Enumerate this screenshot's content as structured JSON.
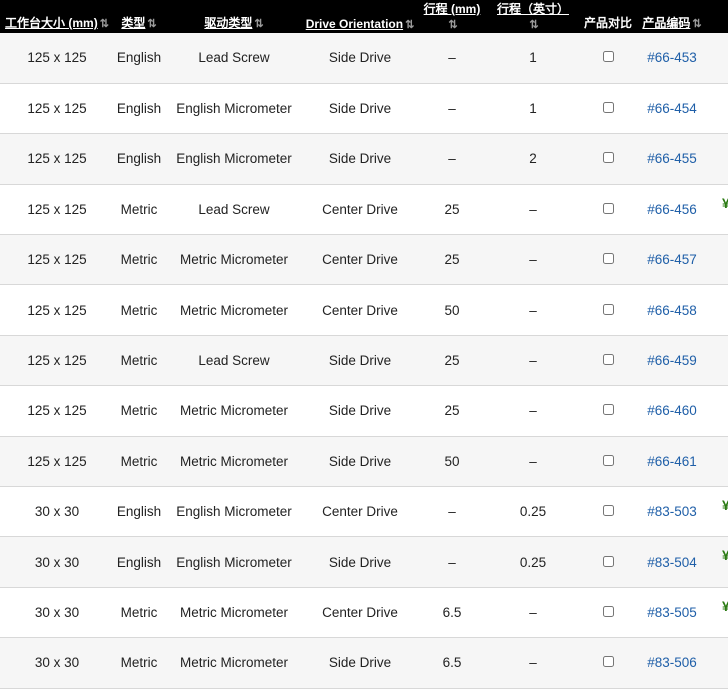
{
  "headers": {
    "stage_size": "工作台大小 (mm)",
    "type": "类型",
    "drive_type": "驱动类型",
    "drive_orientation": "Drive Orientation",
    "travel_mm": "行程 (mm)",
    "travel_in": "行程（英寸）",
    "compare": "产品对比",
    "product_code": "产品编码",
    "sort_icon": "sort-arrows-icon"
  },
  "rows": [
    {
      "size": "125 x 125",
      "type": "English",
      "drive": "Lead Screw",
      "orientation": "Side Drive",
      "travel_mm": "–",
      "travel_in": "1",
      "code": "#66-453"
    },
    {
      "size": "125 x 125",
      "type": "English",
      "drive": "English Micrometer",
      "orientation": "Side Drive",
      "travel_mm": "–",
      "travel_in": "1",
      "code": "#66-454"
    },
    {
      "size": "125 x 125",
      "type": "English",
      "drive": "English Micrometer",
      "orientation": "Side Drive",
      "travel_mm": "–",
      "travel_in": "2",
      "code": "#66-455"
    },
    {
      "size": "125 x 125",
      "type": "Metric",
      "drive": "Lead Screw",
      "orientation": "Center Drive",
      "travel_mm": "25",
      "travel_in": "–",
      "code": "#66-456"
    },
    {
      "size": "125 x 125",
      "type": "Metric",
      "drive": "Metric Micrometer",
      "orientation": "Center Drive",
      "travel_mm": "25",
      "travel_in": "–",
      "code": "#66-457"
    },
    {
      "size": "125 x 125",
      "type": "Metric",
      "drive": "Metric Micrometer",
      "orientation": "Center Drive",
      "travel_mm": "50",
      "travel_in": "–",
      "code": "#66-458"
    },
    {
      "size": "125 x 125",
      "type": "Metric",
      "drive": "Lead Screw",
      "orientation": "Side Drive",
      "travel_mm": "25",
      "travel_in": "–",
      "code": "#66-459"
    },
    {
      "size": "125 x 125",
      "type": "Metric",
      "drive": "Metric Micrometer",
      "orientation": "Side Drive",
      "travel_mm": "25",
      "travel_in": "–",
      "code": "#66-460"
    },
    {
      "size": "125 x 125",
      "type": "Metric",
      "drive": "Metric Micrometer",
      "orientation": "Side Drive",
      "travel_mm": "50",
      "travel_in": "–",
      "code": "#66-461"
    },
    {
      "size": "30 x 30",
      "type": "English",
      "drive": "English Micrometer",
      "orientation": "Center Drive",
      "travel_mm": "–",
      "travel_in": "0.25",
      "code": "#83-503"
    },
    {
      "size": "30 x 30",
      "type": "English",
      "drive": "English Micrometer",
      "orientation": "Side Drive",
      "travel_mm": "–",
      "travel_in": "0.25",
      "code": "#83-504"
    },
    {
      "size": "30 x 30",
      "type": "Metric",
      "drive": "Metric Micrometer",
      "orientation": "Center Drive",
      "travel_mm": "6.5",
      "travel_in": "–",
      "code": "#83-505"
    },
    {
      "size": "30 x 30",
      "type": "Metric",
      "drive": "Metric Micrometer",
      "orientation": "Side Drive",
      "travel_mm": "6.5",
      "travel_in": "–",
      "code": "#83-506"
    }
  ],
  "colors": {
    "header_bg": "#000000",
    "link": "#1f5fa8",
    "edge_green": "#2a7a12"
  }
}
